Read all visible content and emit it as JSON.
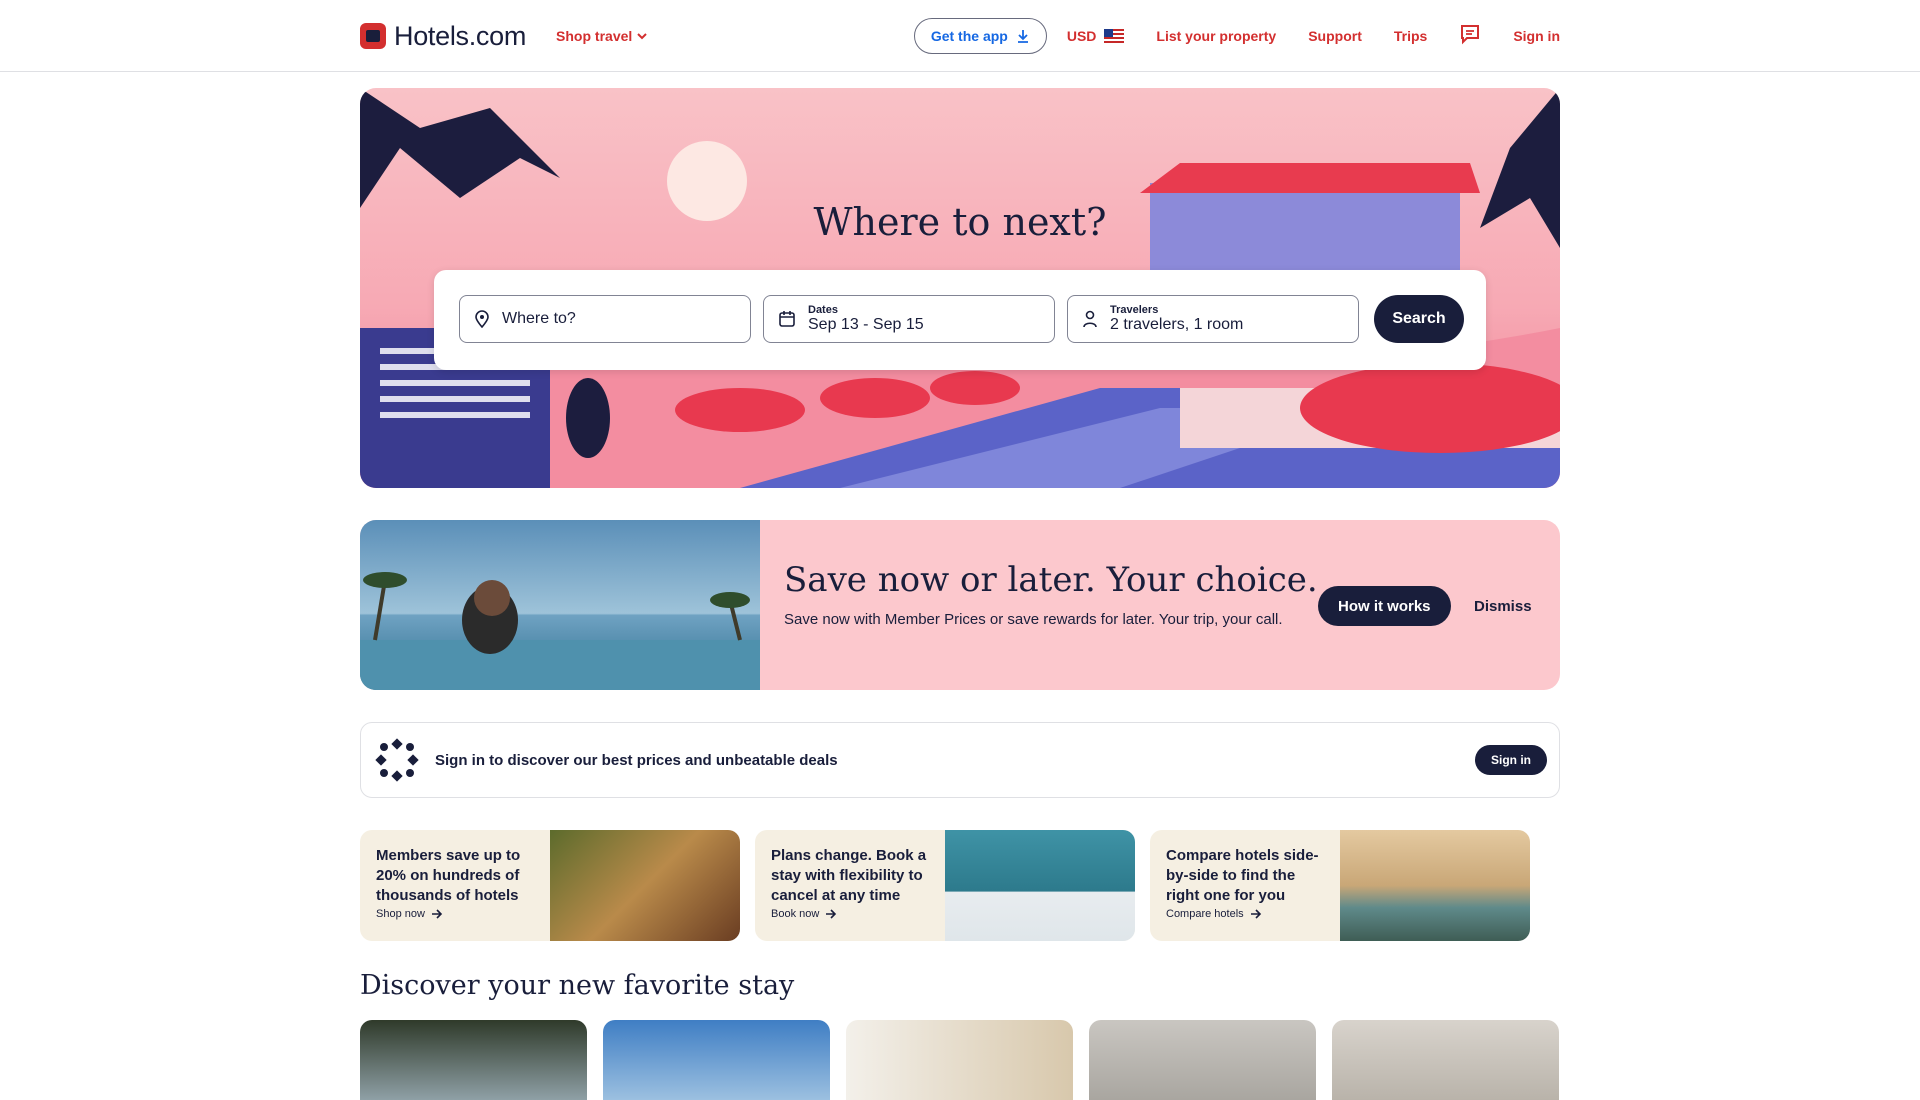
{
  "header": {
    "brand": "Hotels.com",
    "shop_travel": "Shop travel",
    "get_app": "Get the app",
    "currency": "USD",
    "list_property": "List your property",
    "support": "Support",
    "trips": "Trips",
    "sign_in": "Sign in"
  },
  "hero": {
    "title": "Where to next?",
    "destination_placeholder": "Where to?",
    "dates_label": "Dates",
    "dates_value": "Sep 13 - Sep 15",
    "travelers_label": "Travelers",
    "travelers_value": "2 travelers, 1 room",
    "search_button": "Search"
  },
  "banner": {
    "title": "Save now or later. Your choice.",
    "text": "Save now with Member Prices or save rewards for later. Your trip, your call.",
    "how_it_works": "How it works",
    "dismiss": "Dismiss"
  },
  "signin_strip": {
    "text": "Sign in to discover our best prices and unbeatable deals",
    "button": "Sign in"
  },
  "promos": [
    {
      "text": "Members save up to 20% on hundreds of thousands of hotels",
      "link": "Shop now"
    },
    {
      "text": "Plans change. Book a stay with flexibility to cancel at any time",
      "link": "Book now"
    },
    {
      "text": "Compare hotels side-by-side to find the right one for you",
      "link": "Compare hotels"
    }
  ],
  "discover": {
    "title": "Discover your new favorite stay"
  },
  "colors": {
    "brand_red": "#d32f2f",
    "navy": "#191e3b",
    "link_blue": "#1668e3",
    "banner_pink": "#fcc8cd"
  }
}
